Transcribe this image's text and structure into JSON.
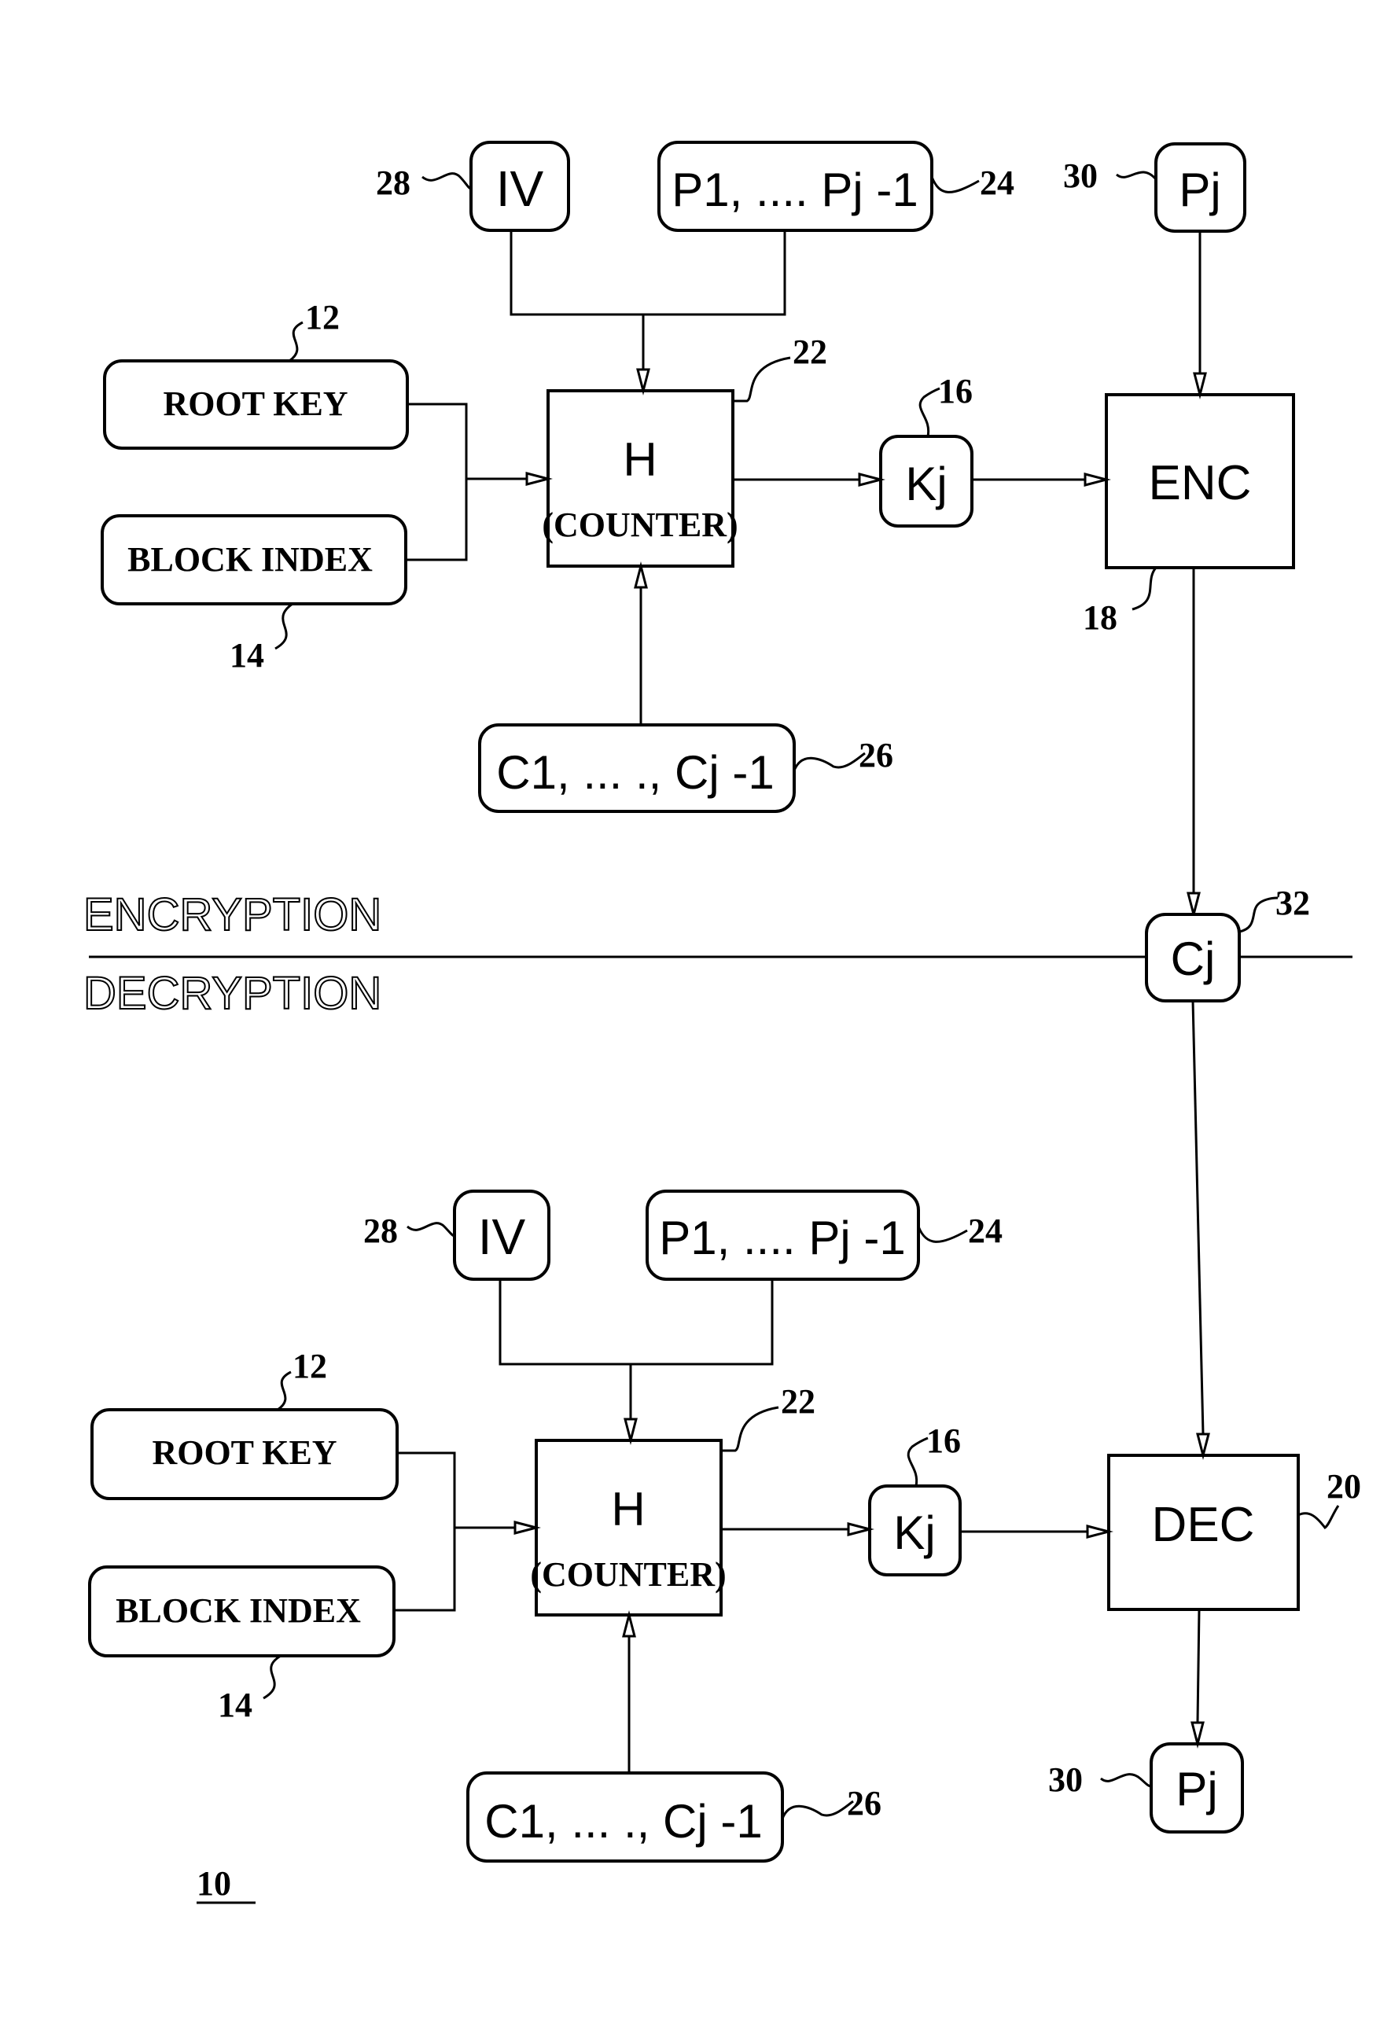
{
  "figure_number": "10",
  "section_labels": {
    "top": "ENCRYPTION",
    "bottom": "DECRYPTION"
  },
  "encryption": {
    "iv": {
      "label": "IV",
      "ref": "28"
    },
    "plaintext_prev": {
      "label": "P1, .... Pj -1",
      "ref": "24"
    },
    "plaintext_current": {
      "label": "Pj",
      "ref": "30"
    },
    "root_key": {
      "label": "ROOT KEY",
      "ref": "12"
    },
    "block_index": {
      "label": "BLOCK INDEX",
      "ref": "14"
    },
    "hash": {
      "label": "H",
      "sublabel": "(COUNTER)",
      "ref": "22"
    },
    "key_j": {
      "label": "Kj",
      "ref": "16"
    },
    "cipher": {
      "label": "ENC",
      "ref": "18"
    },
    "ciphertext_prev": {
      "label": "C1,  ... ., Cj -1",
      "ref": "26"
    }
  },
  "ciphertext_current": {
    "label": "Cj",
    "ref": "32"
  },
  "decryption": {
    "iv": {
      "label": "IV",
      "ref": "28"
    },
    "plaintext_prev": {
      "label": "P1, .... Pj -1",
      "ref": "24"
    },
    "root_key": {
      "label": "ROOT KEY",
      "ref": "12"
    },
    "block_index": {
      "label": "BLOCK INDEX",
      "ref": "14"
    },
    "hash": {
      "label": "H",
      "sublabel": "(COUNTER)",
      "ref": "22"
    },
    "key_j": {
      "label": "Kj",
      "ref": "16"
    },
    "decipher": {
      "label": "DEC",
      "ref": "20"
    },
    "ciphertext_prev": {
      "label": "C1,  ... ., Cj -1",
      "ref": "26"
    },
    "plaintext_current": {
      "label": "Pj",
      "ref": "30"
    }
  }
}
